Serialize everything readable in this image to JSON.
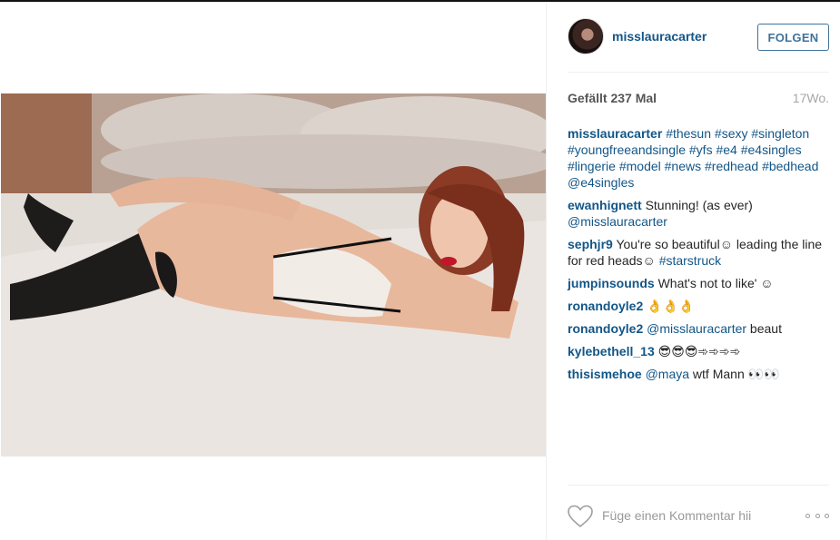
{
  "post": {
    "username": "misslauracarter",
    "follow_label": "FOLGEN",
    "likes": "Gefällt 237 Mal",
    "time": "17Wo.",
    "comment_placeholder": "Füge einen Kommentar hii"
  },
  "comments": [
    {
      "user": "misslauracarter",
      "parts": [
        {
          "text": "#thesun",
          "tag": true
        },
        {
          "text": " "
        },
        {
          "text": "#sexy",
          "tag": true
        },
        {
          "text": " "
        },
        {
          "text": "#singleton",
          "tag": true
        },
        {
          "text": " "
        },
        {
          "text": "#youngfreeandsingle",
          "tag": true
        },
        {
          "text": " "
        },
        {
          "text": "#yfs",
          "tag": true
        },
        {
          "text": " "
        },
        {
          "text": "#e4",
          "tag": true
        },
        {
          "text": " "
        },
        {
          "text": "#e4singles",
          "tag": true
        },
        {
          "text": " "
        },
        {
          "text": "#lingerie",
          "tag": true
        },
        {
          "text": " "
        },
        {
          "text": "#model",
          "tag": true
        },
        {
          "text": " "
        },
        {
          "text": "#news",
          "tag": true
        },
        {
          "text": " "
        },
        {
          "text": "#redhead",
          "tag": true
        },
        {
          "text": " "
        },
        {
          "text": "#bedhead",
          "tag": true
        },
        {
          "text": " "
        },
        {
          "text": "@e4singles",
          "tag": true
        }
      ]
    },
    {
      "user": "ewanhignett",
      "parts": [
        {
          "text": "Stunning! (as ever) "
        },
        {
          "text": "@misslauracarter",
          "tag": true
        }
      ]
    },
    {
      "user": "sephjr9",
      "parts": [
        {
          "text": "You're so beautiful☺ leading the line for red heads☺ "
        },
        {
          "text": "#starstruck",
          "tag": true
        }
      ]
    },
    {
      "user": "jumpinsounds",
      "parts": [
        {
          "text": "What's not to like' ☺"
        }
      ]
    },
    {
      "user": "ronandoyle2",
      "parts": [
        {
          "text": "👌👌👌"
        }
      ]
    },
    {
      "user": "ronandoyle2",
      "parts": [
        {
          "text": "@misslauracarter",
          "tag": true
        },
        {
          "text": " beaut"
        }
      ]
    },
    {
      "user": "kylebethell_13",
      "parts": [
        {
          "text": "😎😎😎➾➾➾➾"
        }
      ]
    },
    {
      "user": "thisismehoe",
      "parts": [
        {
          "text": "@maya",
          "tag": true
        },
        {
          "text": " wtf Mann 👀👀"
        }
      ]
    }
  ],
  "icons": {
    "heart": "heart-icon",
    "more": "more-options-icon"
  },
  "colors": {
    "link": "#125688",
    "follow": "#3f729b"
  }
}
